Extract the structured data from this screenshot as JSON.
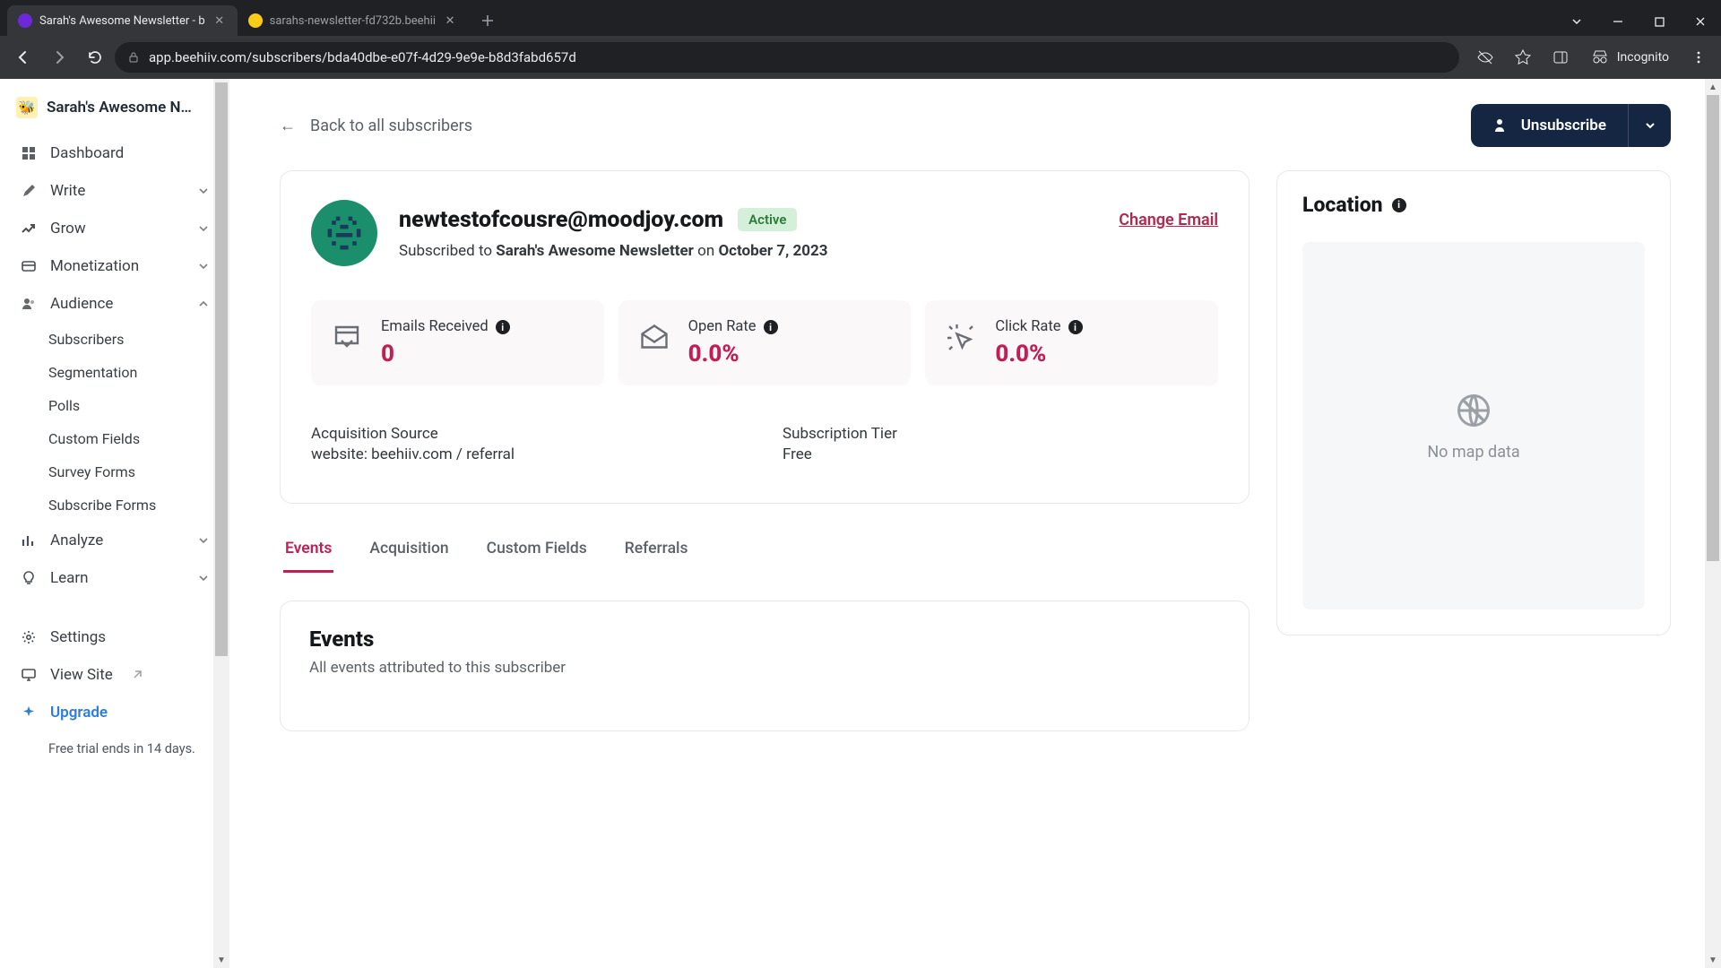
{
  "browser": {
    "tabs": [
      {
        "title": "Sarah's Awesome Newsletter - b",
        "active": true
      },
      {
        "title": "sarahs-newsletter-fd732b.beehii",
        "active": false
      }
    ],
    "url": "app.beehiiv.com/subscribers/bda40dbe-e07f-4d29-9e9e-b8d3fabd657d",
    "incognito_label": "Incognito"
  },
  "sidebar": {
    "workspace_name": "Sarah's Awesome N…",
    "items": {
      "dashboard": "Dashboard",
      "write": "Write",
      "grow": "Grow",
      "monetization": "Monetization",
      "audience": "Audience",
      "analyze": "Analyze",
      "learn": "Learn",
      "settings": "Settings",
      "view_site": "View Site",
      "upgrade": "Upgrade"
    },
    "audience_sub": {
      "subscribers": "Subscribers",
      "segmentation": "Segmentation",
      "polls": "Polls",
      "custom_fields": "Custom Fields",
      "survey_forms": "Survey Forms",
      "subscribe_forms": "Subscribe Forms"
    },
    "trial_note": "Free trial ends in 14 days."
  },
  "header": {
    "back_label": "Back to all subscribers",
    "unsubscribe_label": "Unsubscribe"
  },
  "profile": {
    "email": "newtestofcousre@moodjoy.com",
    "status_badge": "Active",
    "change_email_label": "Change Email",
    "subscribed_prefix": "Subscribed to ",
    "newsletter_name": "Sarah's Awesome Newsletter",
    "subscribed_mid": " on ",
    "subscribed_date": "October 7, 2023"
  },
  "stats": {
    "emails": {
      "title": "Emails Received",
      "value": "0"
    },
    "open": {
      "title": "Open Rate",
      "value": "0.0%"
    },
    "click": {
      "title": "Click Rate",
      "value": "0.0%"
    }
  },
  "meta": {
    "source_label": "Acquisition Source",
    "source_value": "website: beehiiv.com / referral",
    "tier_label": "Subscription Tier",
    "tier_value": "Free"
  },
  "tabs": {
    "events": "Events",
    "acquisition": "Acquisition",
    "custom_fields": "Custom Fields",
    "referrals": "Referrals"
  },
  "events_panel": {
    "title": "Events",
    "subtitle": "All events attributed to this subscriber"
  },
  "location": {
    "title": "Location",
    "no_data": "No map data"
  }
}
